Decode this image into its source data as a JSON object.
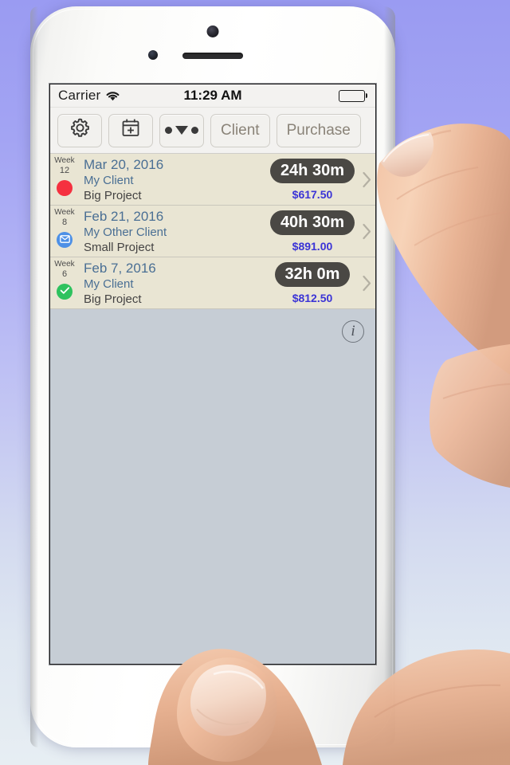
{
  "status_bar": {
    "carrier": "Carrier",
    "time": "11:29 AM",
    "wifi_icon": "wifi-icon",
    "battery_icon": "battery-full-icon"
  },
  "toolbar": {
    "settings_icon": "gear-icon",
    "add_icon": "calendar-plus-icon",
    "sort_icon": "sort-dots-icon",
    "client_label": "Client",
    "purchase_label": "Purchase"
  },
  "entries": [
    {
      "week_label": "Week",
      "week_number": "12",
      "status": "red",
      "status_icon": "circle-icon",
      "date": "Mar 20, 2016",
      "client": "My Client",
      "project": "Big Project",
      "duration": "24h 30m",
      "amount": "$617.50"
    },
    {
      "week_label": "Week",
      "week_number": "8",
      "status": "blue",
      "status_icon": "envelope-icon",
      "date": "Feb 21, 2016",
      "client": "My Other Client",
      "project": "Small Project",
      "duration": "40h 30m",
      "amount": "$891.00"
    },
    {
      "week_label": "Week",
      "week_number": "6",
      "status": "green",
      "status_icon": "check-icon",
      "date": "Feb 7, 2016",
      "client": "My Client",
      "project": "Big Project",
      "duration": "32h 0m",
      "amount": "$812.50"
    }
  ],
  "info_button": {
    "label": "i",
    "icon": "info-circle-icon"
  },
  "colors": {
    "screen_background": "#c6cdd5",
    "row_background": "#e9e5d3",
    "toolbar_background": "#f3f2f0",
    "duration_pill": "#4a4844",
    "amount_text": "#3b34d6",
    "link_text": "#4a6f94",
    "status_red": "#f5303f",
    "status_blue": "#4d90e6",
    "status_green": "#2ec25e",
    "page_gradient_top": "#9a9bf2",
    "page_gradient_bottom": "#e7eef3"
  }
}
